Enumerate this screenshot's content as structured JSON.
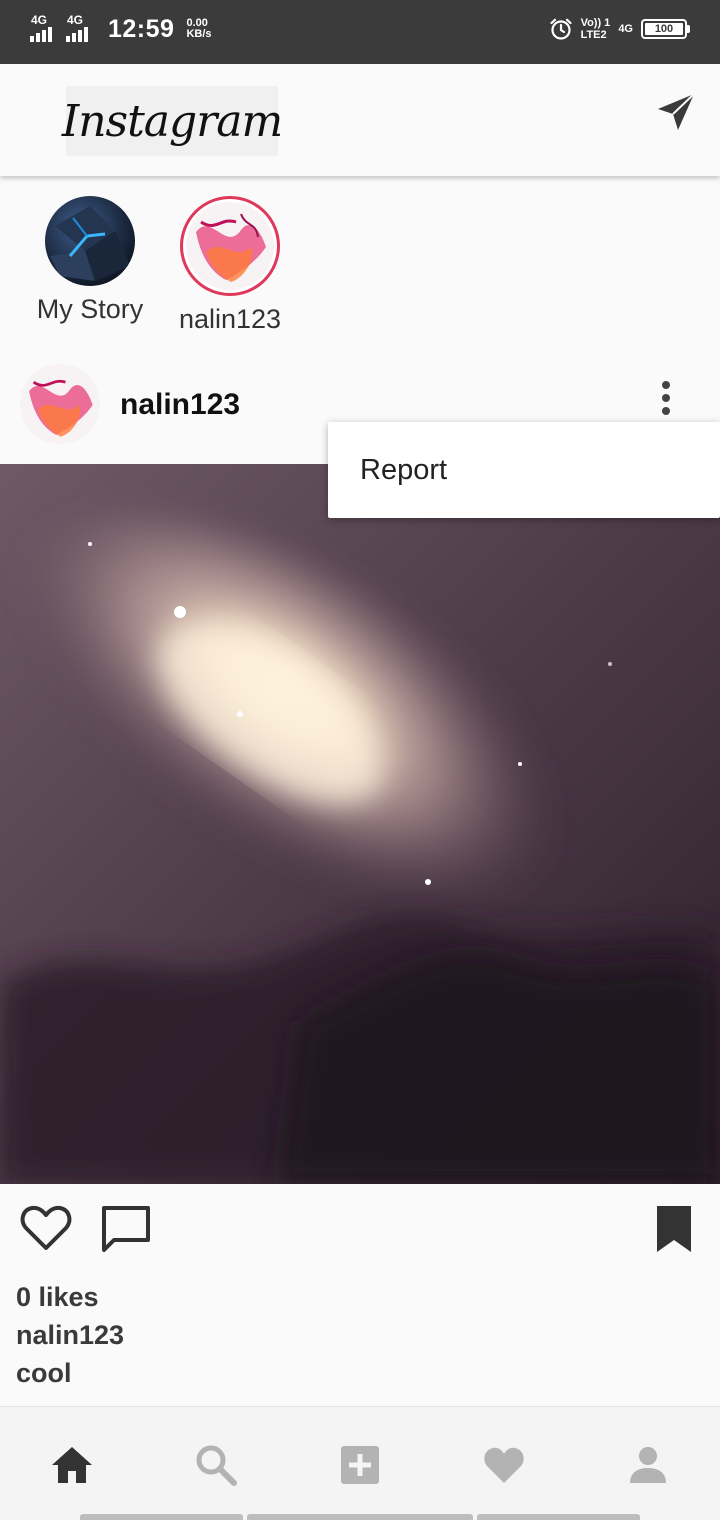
{
  "status_bar": {
    "sim1_net": "4G",
    "sim2_net": "4G",
    "time": "12:59",
    "speed_value": "0.00",
    "speed_unit": "KB/s",
    "volte_top": "Vo)) 1",
    "volte_bottom": "LTE2",
    "net_right": "4G",
    "battery": "100",
    "icons": [
      "signal-icon",
      "alarm-icon",
      "battery-icon"
    ]
  },
  "app_bar": {
    "logo": "Instagram",
    "direct_icon": "send-icon"
  },
  "stories": [
    {
      "label": "My Story"
    },
    {
      "label": "nalin123"
    }
  ],
  "post": {
    "username": "nalin123",
    "likes": "0 likes",
    "caption_user": "nalin123",
    "caption_text": "cool"
  },
  "menu": {
    "items": [
      "Report"
    ]
  },
  "bottom_nav": {
    "items": [
      "home-icon",
      "search-icon",
      "add-icon",
      "heart-icon",
      "profile-icon"
    ]
  },
  "colors": {
    "status_bar": "#3b3b3b",
    "background": "#fafafa",
    "icon_dark": "#333333",
    "icon_muted": "#b3b3b3"
  }
}
